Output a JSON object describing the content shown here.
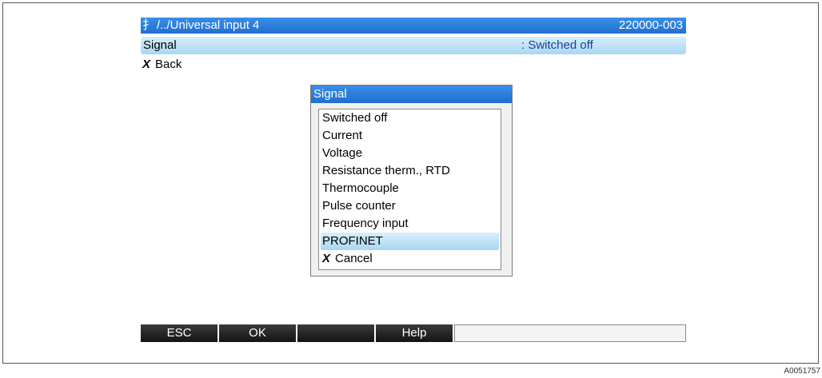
{
  "header": {
    "menu_icon": "menu-symbol-icon",
    "menu_glyph": "扌",
    "path": "/../Universal input 4",
    "device_id": "220000-003"
  },
  "parameter": {
    "label": "Signal",
    "value": ": Switched off"
  },
  "back": {
    "icon_glyph": "X",
    "label": "Back"
  },
  "dialog": {
    "title": "Signal",
    "items": [
      {
        "label": "Switched off"
      },
      {
        "label": "Current"
      },
      {
        "label": "Voltage"
      },
      {
        "label": "Resistance therm., RTD"
      },
      {
        "label": "Thermocouple"
      },
      {
        "label": "Pulse counter"
      },
      {
        "label": "Frequency input"
      },
      {
        "label": "PROFINET"
      }
    ],
    "selected_index": 7,
    "cancel": {
      "icon_glyph": "X",
      "label": "Cancel"
    }
  },
  "softkeys": [
    {
      "label": "ESC"
    },
    {
      "label": "OK"
    },
    {
      "label": ""
    },
    {
      "label": "Help"
    },
    {
      "label": ""
    }
  ],
  "figure_ref": "A0051757",
  "colors": {
    "title_bar": "#1f6fd1",
    "highlight": "#a9d7f3",
    "param_value": "#1a3fa0",
    "softkey": "#141414"
  }
}
